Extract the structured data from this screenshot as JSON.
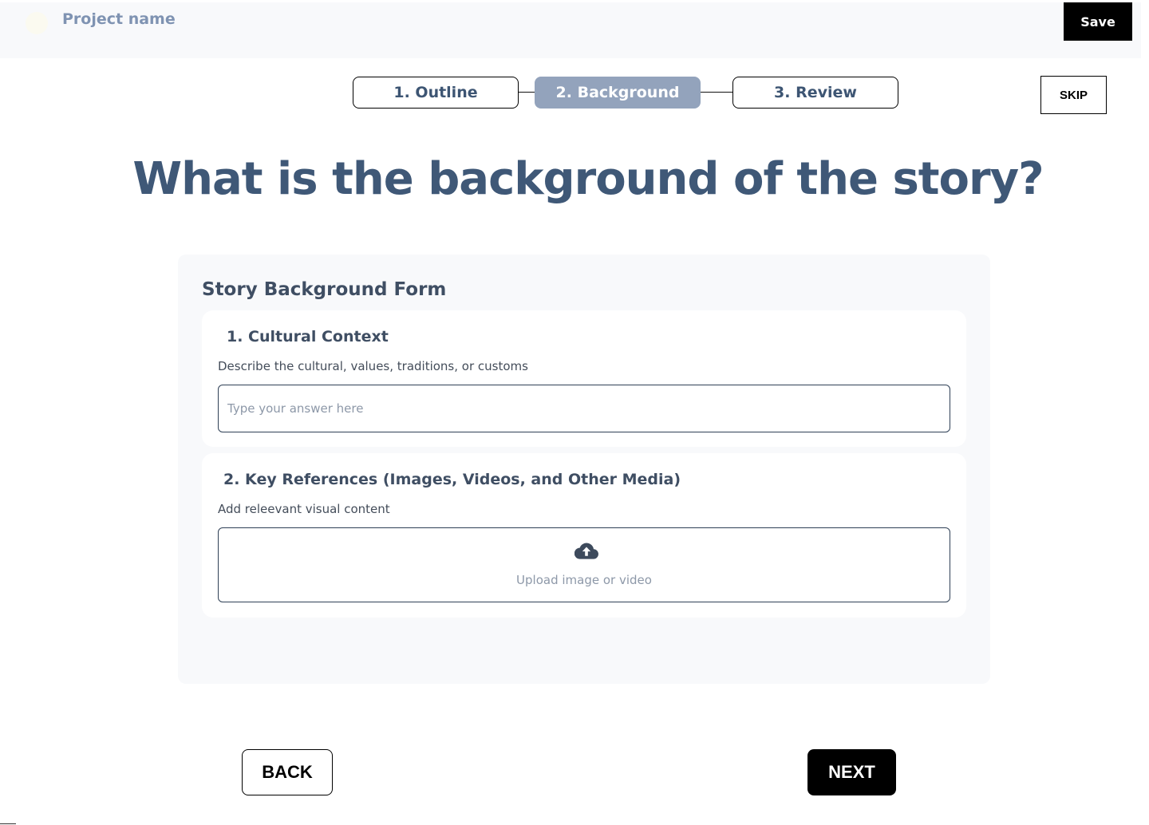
{
  "header": {
    "project_name": "Project name",
    "save_label": "Save"
  },
  "stepper": {
    "steps": [
      {
        "label": "1. Outline",
        "active": false
      },
      {
        "label": "2. Background",
        "active": true
      },
      {
        "label": "3. Review",
        "active": false
      }
    ],
    "skip_label": "SKIP"
  },
  "main": {
    "title": "What is the background of the story?"
  },
  "form": {
    "title": "Story Background Form",
    "questions": [
      {
        "title": "1. Cultural Context",
        "description": "Describe the cultural, values, traditions, or customs",
        "placeholder": "Type your answer here",
        "value": ""
      },
      {
        "title": "2. Key References (Images, Videos, and Other Media)",
        "description": "Add releevant visual content",
        "upload_label": "Upload image or video",
        "icon": "cloud-upload-icon"
      }
    ]
  },
  "footer": {
    "back_label": "BACK",
    "next_label": "NEXT"
  },
  "colors": {
    "title": "#3f5877",
    "active_step": "#93a3bc",
    "panel_bg": "#f8f9fb",
    "primary_button": "#000000"
  }
}
